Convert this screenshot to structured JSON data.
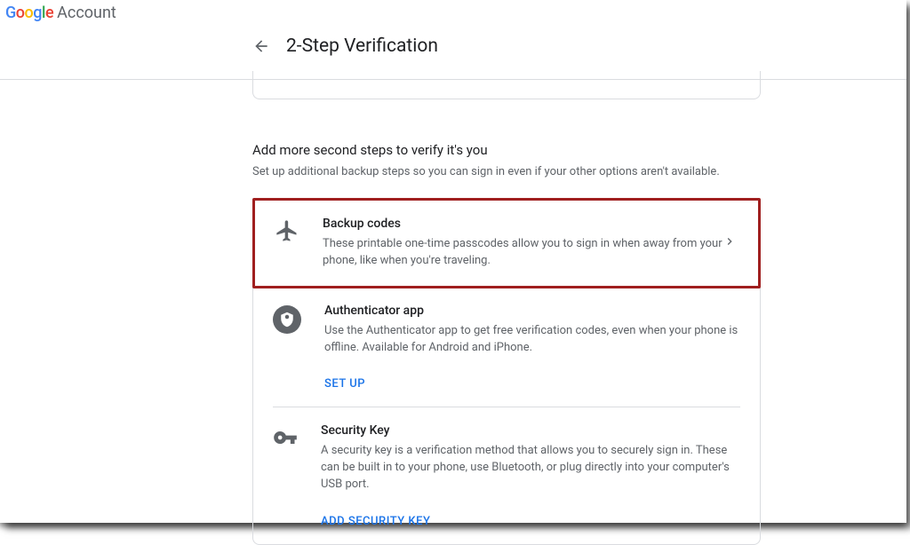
{
  "header": {
    "brand": "Google",
    "account": "Account"
  },
  "subheader": {
    "title": "2-Step Verification"
  },
  "section": {
    "title": "Add more second steps to verify it's you",
    "subtitle": "Set up additional backup steps so you can sign in even if your other options aren't available."
  },
  "options": {
    "backup_codes": {
      "title": "Backup codes",
      "description": "These printable one-time passcodes allow you to sign in when away from your phone, like when you're traveling."
    },
    "authenticator": {
      "title": "Authenticator app",
      "description": "Use the Authenticator app to get free verification codes, even when your phone is offline. Available for Android and iPhone.",
      "action": "SET UP"
    },
    "security_key": {
      "title": "Security Key",
      "description": "A security key is a verification method that allows you to securely sign in. These can be built in to your phone, use Bluetooth, or plug directly into your computer's USB port.",
      "action": "ADD SECURITY KEY"
    }
  }
}
